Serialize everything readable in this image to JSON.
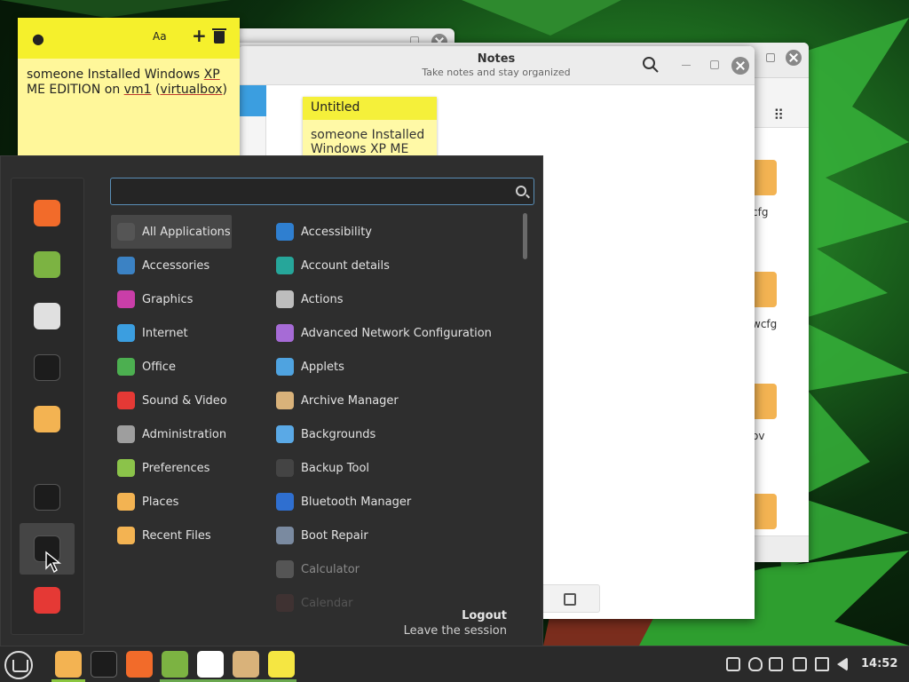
{
  "sticky_note": {
    "text_prefix": "someone Installed Windows ",
    "text_xp": "XP",
    "text_mid": " ME EDITION on ",
    "text_vm": "vm1",
    "text_paren_open": " (",
    "text_vb": "virtualbox",
    "text_paren_close": ")",
    "font_button_label": "Aa",
    "add_button_label": "+"
  },
  "notes_window": {
    "title": "Notes",
    "subtitle": "Take notes and stay organized",
    "card_title": "Untitled",
    "card_body": "someone Installed Windows XP ME"
  },
  "file_manager": {
    "items": [
      {
        "label": "cfg"
      },
      {
        "label": "wcfg"
      },
      {
        "label": "ov"
      }
    ]
  },
  "menu": {
    "categories": [
      {
        "label": "All Applications",
        "icon": "grid-icon",
        "color": "#555555"
      },
      {
        "label": "Accessories",
        "icon": "accessories-icon",
        "color": "#3b82c4"
      },
      {
        "label": "Graphics",
        "icon": "graphics-icon",
        "color": "#c93ea8"
      },
      {
        "label": "Internet",
        "icon": "internet-icon",
        "color": "#3b9ee0"
      },
      {
        "label": "Office",
        "icon": "office-icon",
        "color": "#4caf50"
      },
      {
        "label": "Sound & Video",
        "icon": "media-icon",
        "color": "#e53935"
      },
      {
        "label": "Administration",
        "icon": "admin-icon",
        "color": "#9e9e9e"
      },
      {
        "label": "Preferences",
        "icon": "preferences-icon",
        "color": "#8bc34a"
      },
      {
        "label": "Places",
        "icon": "folder-icon",
        "color": "#f3b352"
      },
      {
        "label": "Recent Files",
        "icon": "recent-files-icon",
        "color": "#f3b352"
      }
    ],
    "apps": [
      {
        "label": "Accessibility",
        "icon": "accessibility-icon",
        "color": "#2f7fd0"
      },
      {
        "label": "Account details",
        "icon": "account-icon",
        "color": "#26a69a"
      },
      {
        "label": "Actions",
        "icon": "actions-icon",
        "color": "#bdbdbd"
      },
      {
        "label": "Advanced Network Configuration",
        "icon": "network-icon",
        "color": "#a66bd6"
      },
      {
        "label": "Applets",
        "icon": "applets-icon",
        "color": "#4fa3e0"
      },
      {
        "label": "Archive Manager",
        "icon": "archive-icon",
        "color": "#d9b27a"
      },
      {
        "label": "Backgrounds",
        "icon": "backgrounds-icon",
        "color": "#5aa9e6"
      },
      {
        "label": "Backup Tool",
        "icon": "backup-icon",
        "color": "#444444"
      },
      {
        "label": "Bluetooth Manager",
        "icon": "bluetooth-icon",
        "color": "#2f6fd0"
      },
      {
        "label": "Boot Repair",
        "icon": "boot-repair-icon",
        "color": "#7a8aa0"
      },
      {
        "label": "Calculator",
        "icon": "calculator-icon",
        "color": "#555555"
      },
      {
        "label": "Calendar",
        "icon": "calendar-icon",
        "color": "#5a3a3a"
      }
    ],
    "session_title": "Logout",
    "session_subtitle": "Leave the session",
    "favorites": [
      {
        "name": "firefox-icon",
        "color": "#f26b2a"
      },
      {
        "name": "software-manager-icon",
        "color": "#7cb342"
      },
      {
        "name": "settings-toggle-icon",
        "color": "#e0e0e0"
      },
      {
        "name": "terminal-icon",
        "color": "#1c1c1c"
      },
      {
        "name": "files-icon",
        "color": "#f3b352"
      },
      {
        "name": "lock-icon",
        "color": "#1c1c1c"
      },
      {
        "name": "logout-icon",
        "color": "#1c1c1c"
      },
      {
        "name": "power-icon",
        "color": "#e53935"
      }
    ]
  },
  "taskbar": {
    "clock": "14:52",
    "apps": [
      {
        "name": "files-taskbar-icon",
        "color": "#f3b352"
      },
      {
        "name": "terminal-taskbar-icon",
        "color": "#1c1c1c"
      },
      {
        "name": "firefox-taskbar-icon",
        "color": "#f26b2a"
      },
      {
        "name": "mint-update-taskbar-icon",
        "color": "#7cb342"
      },
      {
        "name": "settings-taskbar-icon",
        "color": "#ffffff"
      },
      {
        "name": "archive-taskbar-icon",
        "color": "#d9b27a"
      },
      {
        "name": "notes-taskbar-icon",
        "color": "#f5e642"
      }
    ]
  }
}
